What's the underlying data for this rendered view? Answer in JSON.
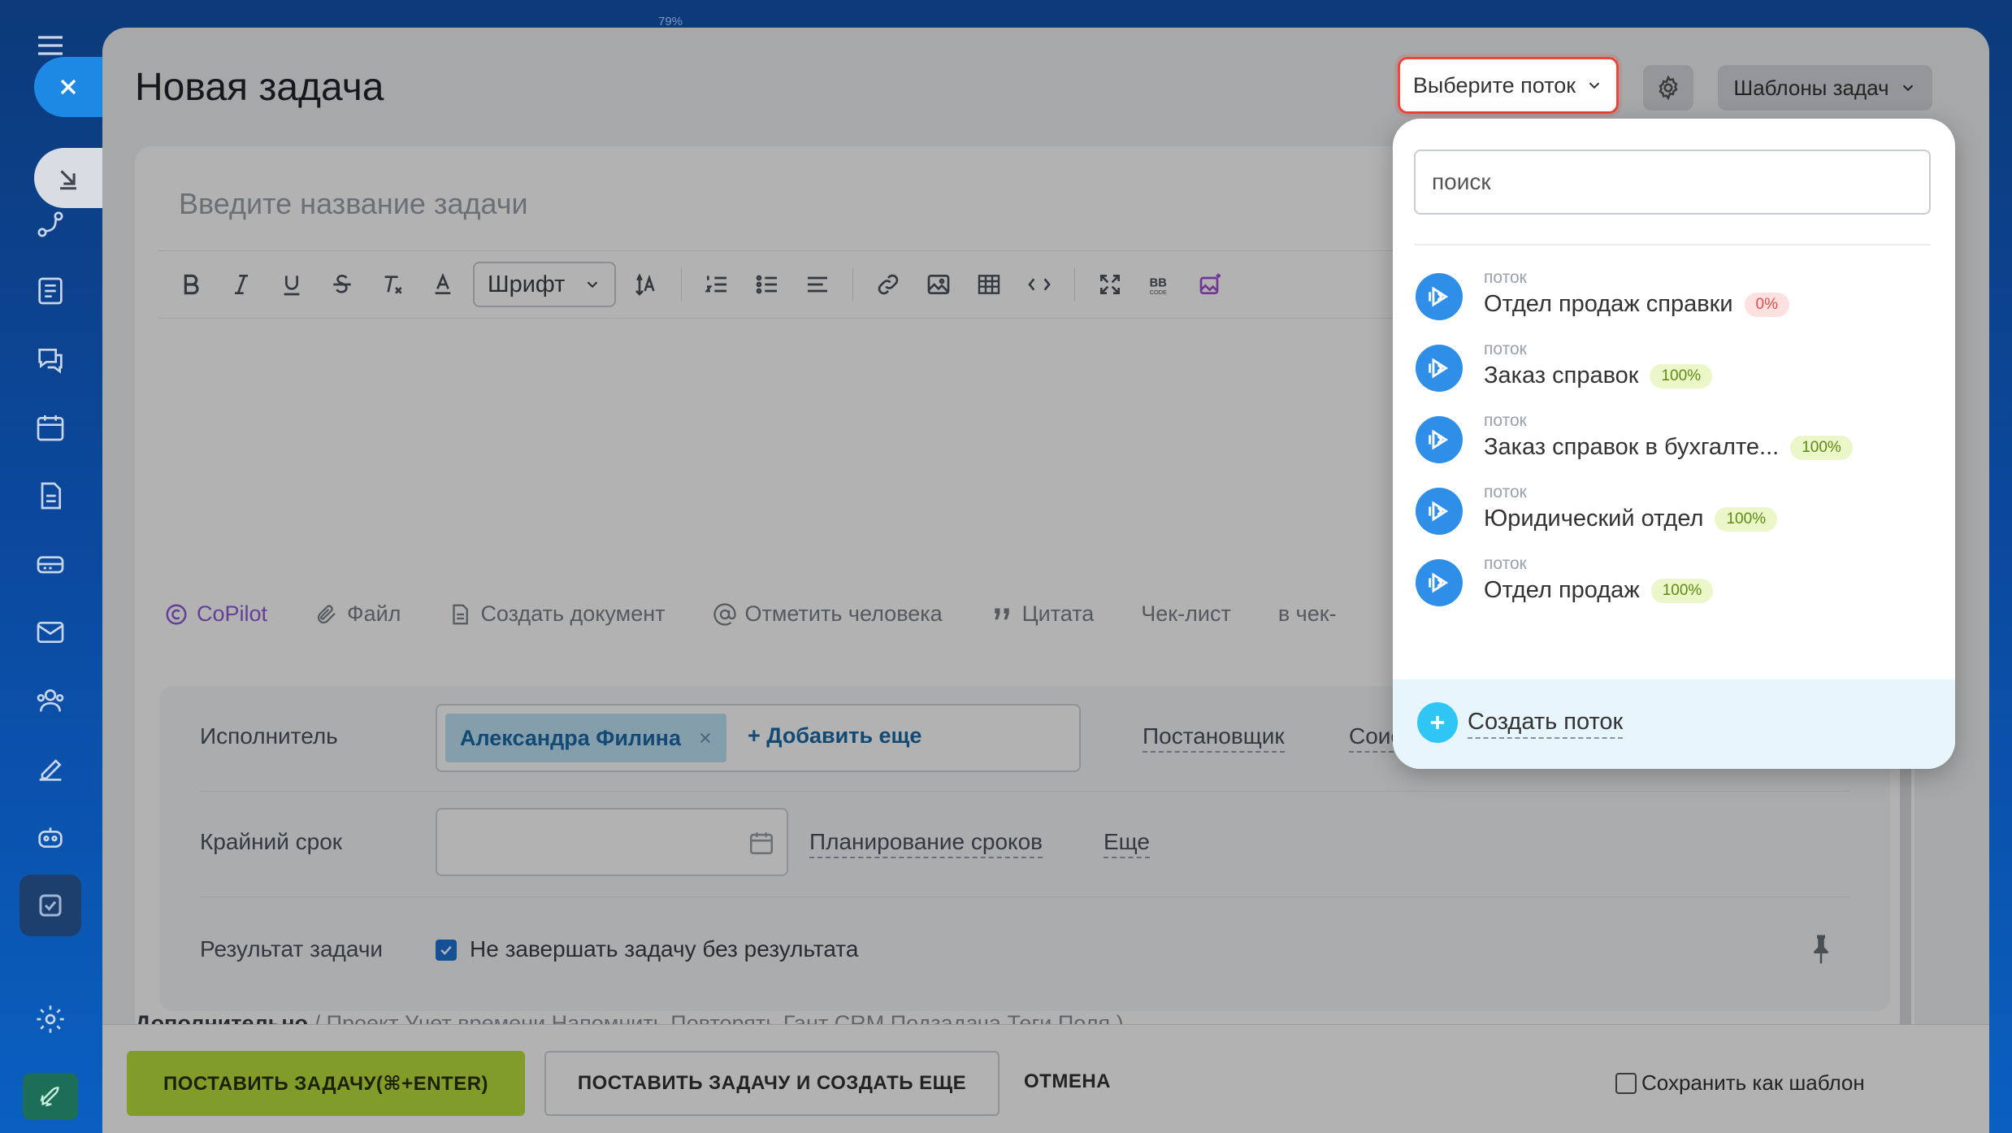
{
  "topbar": {
    "zoom": "79%"
  },
  "page": {
    "title": "Новая задача"
  },
  "header": {
    "flow_select_label": "Выберите поток",
    "templates_label": "Шаблоны задач"
  },
  "editor": {
    "title_placeholder": "Введите название задачи",
    "font_label": "Шрифт"
  },
  "attachments": {
    "copilot": "CoPilot",
    "file": "Файл",
    "create_doc": "Создать документ",
    "mention": "Отметить человека",
    "quote": "Цитата",
    "checklist": "Чек-лист",
    "in_checklist": "в чек-"
  },
  "fields": {
    "assignee_label": "Исполнитель",
    "assignee_name": "Александра Филина",
    "add_more": "+ Добавить еще",
    "creator_link": "Постановщик",
    "coexecutor_link": "Соисполни",
    "deadline_label": "Крайний срок",
    "planning_link": "Планирование сроков",
    "more_link": "Еще",
    "result_label": "Результат задачи",
    "result_checkbox": "Не завершать задачу без результата"
  },
  "additional": {
    "title": "Дополнительно",
    "tabs": "/ Проект   Учет времени   Напомнить   Повторять   Гант   CRM   Подзадача   Теги   Поля )"
  },
  "bottom": {
    "submit": "ПОСТАВИТЬ ЗАДАЧУ(⌘+ENTER)",
    "submit_and_new": "ПОСТАВИТЬ ЗАДАЧУ И СОЗДАТЬ ЕЩЕ",
    "cancel": "ОТМЕНА",
    "save_template": "Сохранить как шаблон"
  },
  "dropdown": {
    "search_placeholder": "поиск",
    "items": [
      {
        "kind": "поток",
        "name": "Отдел продаж справки",
        "pct": "0%"
      },
      {
        "kind": "поток",
        "name": "Заказ справок",
        "pct": "100%"
      },
      {
        "kind": "поток",
        "name": "Заказ справок в бухгалте...",
        "pct": "100%"
      },
      {
        "kind": "поток",
        "name": "Юридический отдел",
        "pct": "100%"
      },
      {
        "kind": "поток",
        "name": "Отдел продаж",
        "pct": "100%"
      }
    ],
    "create_label": "Создать поток"
  },
  "colors": {
    "accent": "#1e88e5",
    "primary_button": "#b9e03a",
    "highlight_border": "#f0443c",
    "flow_avatar": "#2f8fe8",
    "pct_zero": "#e04b4b",
    "pct_full": "#5d8b10"
  }
}
